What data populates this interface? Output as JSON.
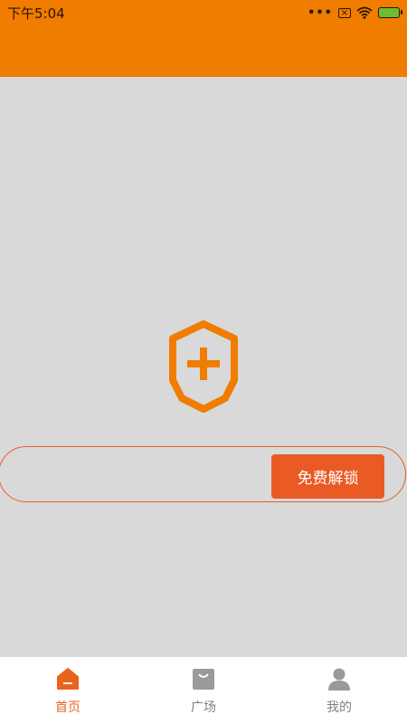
{
  "status_bar": {
    "time": "下午5:04",
    "dots": "•••",
    "sim_icon": "sim-x-icon",
    "wifi_icon": "wifi-icon",
    "battery_icon": "battery-charging-icon"
  },
  "main": {
    "center_icon": "shield-plus-icon",
    "unlock_button": "免费解锁"
  },
  "tabs": [
    {
      "label": "首页",
      "icon": "home-icon",
      "active": true
    },
    {
      "label": "广场",
      "icon": "bag-icon",
      "active": false
    },
    {
      "label": "我的",
      "icon": "user-icon",
      "active": false
    }
  ],
  "colors": {
    "header": "#f07c00",
    "accent": "#ea5a25",
    "background": "#d9d9d9",
    "tab_active": "#e9631f",
    "tab_inactive": "#808080"
  }
}
